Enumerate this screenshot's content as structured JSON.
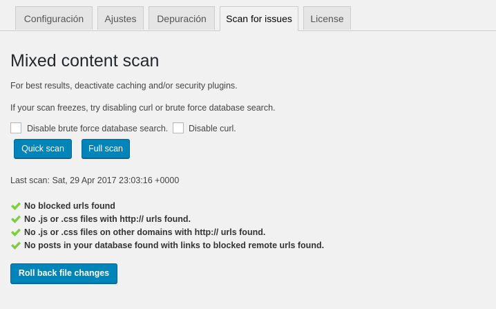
{
  "tabs": [
    {
      "label": "Configuración",
      "active": false
    },
    {
      "label": "Ajustes",
      "active": false
    },
    {
      "label": "Depuración",
      "active": false
    },
    {
      "label": "Scan for issues",
      "active": true
    },
    {
      "label": "License",
      "active": false
    }
  ],
  "main": {
    "title": "Mixed content scan",
    "hint_1": "For best results, deactivate caching and/or security plugins.",
    "hint_2": "If your scan freezes, try disabling curl or brute force database search.",
    "options": {
      "bruteforce_label": "Disable brute force database search.",
      "bruteforce_checked": false,
      "curl_label": "Disable curl.",
      "curl_checked": false
    },
    "buttons": {
      "quick_scan": "Quick scan",
      "full_scan": "Full scan",
      "rollback": "Roll back file changes"
    },
    "last_scan": "Last scan: Sat, 29 Apr 2017 23:03:16 +0000",
    "results": [
      {
        "icon": "checkmark-icon",
        "text": "No blocked urls found"
      },
      {
        "icon": "checkmark-icon",
        "text": "No .js or .css files with http:// urls found."
      },
      {
        "icon": "checkmark-icon",
        "text": "No .js or .css files on other domains with http:// urls found."
      },
      {
        "icon": "checkmark-icon",
        "text": "No posts in your database found with links to blocked remote urls found."
      }
    ]
  },
  "colors": {
    "background": "#f1f1f1",
    "primary_button": "#0085ba",
    "success_check": "#7ad03a"
  }
}
